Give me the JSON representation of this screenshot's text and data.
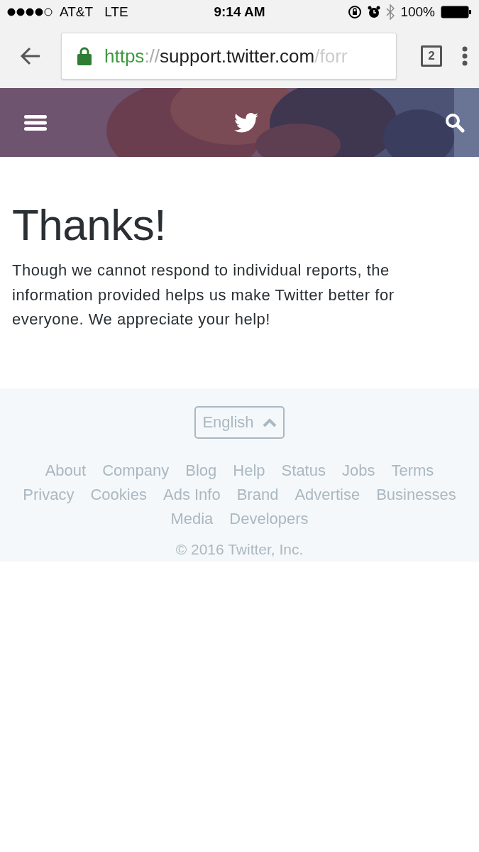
{
  "status_bar": {
    "carrier": "AT&T",
    "network": "LTE",
    "time": "9:14 AM",
    "battery": "100%"
  },
  "browser": {
    "url": {
      "scheme": "https",
      "separator": "://",
      "host": "support.twitter.com",
      "path": "/forr"
    },
    "tab_count": "2"
  },
  "content": {
    "title": "Thanks!",
    "body": "Though we cannot respond to individual reports, the information provided helps us make Twitter better for everyone. We appreciate your help!"
  },
  "footer": {
    "language": "English",
    "links": [
      "About",
      "Company",
      "Blog",
      "Help",
      "Status",
      "Jobs",
      "Terms",
      "Privacy",
      "Cookies",
      "Ads Info",
      "Brand",
      "Advertise",
      "Businesses",
      "Media",
      "Developers"
    ],
    "copyright": "© 2016 Twitter, Inc."
  }
}
